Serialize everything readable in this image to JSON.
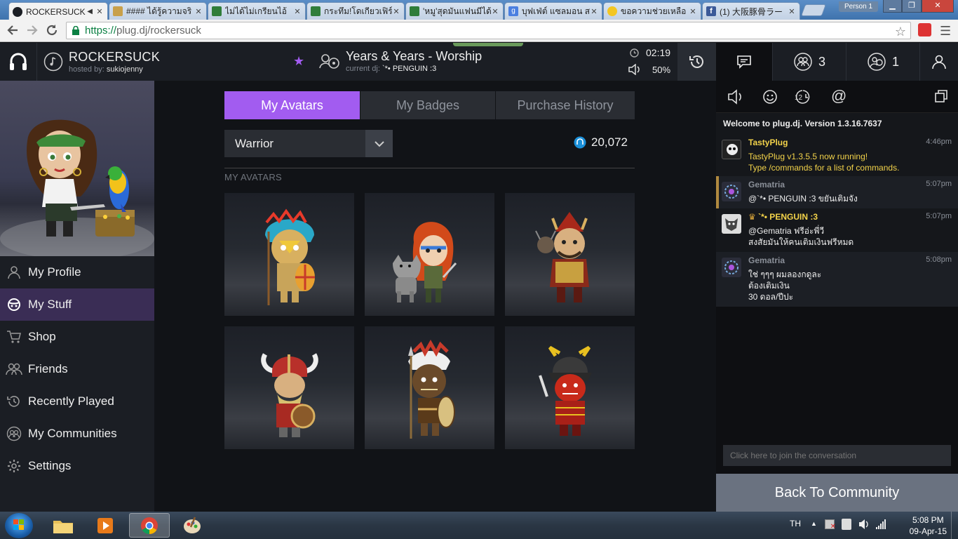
{
  "browser": {
    "tabs": [
      {
        "title": "ROCKERSUCK",
        "favicon": "plug-icon",
        "active": true
      },
      {
        "title": "#### ได้รู้ความจริ",
        "favicon": "lock-icon"
      },
      {
        "title": "ไม่ได้ไม่เกรียนไอ้",
        "favicon": "pantip-icon"
      },
      {
        "title": "กระทึม!โดเกียวเฟิร์",
        "favicon": "pantip-icon"
      },
      {
        "title": "'หมู'สุดมันแฟนมีได้",
        "favicon": "pantip-icon"
      },
      {
        "title": "บุฟเฟ่ต์ แซลมอน ส",
        "favicon": "google-icon"
      },
      {
        "title": "ขอความช่วยเหลือ เ",
        "favicon": "smiley-icon"
      },
      {
        "title": "(1) 大阪豚骨ラー",
        "favicon": "facebook-icon"
      }
    ],
    "profile_label": "Person 1",
    "url_https": "https://",
    "url_rest": "plug.dj/rockersuck"
  },
  "room": {
    "name": "ROCKERSUCK",
    "hosted_by_label": "hosted by:",
    "host": "sukiojenny"
  },
  "now_playing": {
    "song": "Years & Years - Worship",
    "current_dj_label": "current dj:",
    "current_dj": "`*• PENGUIN :3"
  },
  "playback": {
    "time_remaining": "02:19",
    "volume": "50%"
  },
  "right_tabs": {
    "audience_count": "3",
    "waitlist_count": "1"
  },
  "chat": {
    "welcome": "Welcome to plug.dj. Version 1.3.16.7637",
    "messages": [
      {
        "user": "TastyPlug",
        "time": "4:46pm",
        "lines": [
          "TastyPlug v1.3.5.5 now running!",
          "Type /commands for a list of commands."
        ],
        "color": "#f3d34a"
      },
      {
        "user": "Gematria",
        "time": "5:07pm",
        "lines": [
          "@`*• PENGUIN :3 ขยันเติมจัง"
        ],
        "color": "#8a8f98"
      },
      {
        "user": "`*• PENGUIN :3",
        "time": "5:07pm",
        "lines": [
          "@Gematria ฟรีอ่ะพี่วี",
          "สงสัยมันให้คนเติมเงินฟรีหมด"
        ],
        "color": "#f3d34a"
      },
      {
        "user": "Gematria",
        "time": "5:08pm",
        "lines": [
          "ใช่ ๆๆๆ ผมลองกดูละ",
          "ต้องเติมเงิน",
          "30 ดอล/ปีปะ"
        ],
        "color": "#8a8f98"
      }
    ],
    "input_placeholder": "Click here to join the conversation",
    "back_button": "Back To Community"
  },
  "sidebar": {
    "items": [
      {
        "label": "My Profile",
        "icon": "user-icon"
      },
      {
        "label": "My Stuff",
        "icon": "stuff-icon",
        "active": true
      },
      {
        "label": "Shop",
        "icon": "cart-icon"
      },
      {
        "label": "Friends",
        "icon": "friends-icon"
      },
      {
        "label": "Recently Played",
        "icon": "history-icon"
      },
      {
        "label": "My Communities",
        "icon": "communities-icon"
      },
      {
        "label": "Settings",
        "icon": "gear-icon"
      }
    ]
  },
  "main": {
    "tabs": [
      {
        "label": "My Avatars",
        "active": true
      },
      {
        "label": "My Badges"
      },
      {
        "label": "Purchase History"
      }
    ],
    "dropdown_value": "Warrior",
    "points": "20,072",
    "section_label": "MY AVATARS",
    "avatars": [
      "aztec-warrior",
      "wolf-huntress",
      "mongol-warrior",
      "viking",
      "tribal-warrior",
      "samurai"
    ]
  },
  "taskbar": {
    "lang": "TH",
    "time": "5:08 PM",
    "date": "09-Apr-15"
  },
  "colors": {
    "accent": "#a25cf0",
    "active_nav": "#3a2d55",
    "chat_name_gold": "#f3d34a"
  }
}
